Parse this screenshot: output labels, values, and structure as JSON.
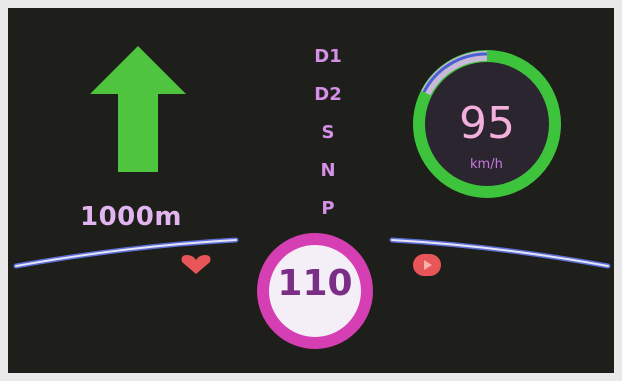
{
  "navigation": {
    "direction_icon": "arrow-up-icon",
    "distance": "1000m",
    "arrow_color": "#4ec43f"
  },
  "gear_selector": {
    "items": [
      "D1",
      "D2",
      "S",
      "N",
      "P"
    ],
    "color": "#d48fe6"
  },
  "speedometer": {
    "value": "95",
    "unit": "km/h",
    "ring_color": "#3ec43c",
    "accent_color": "#4a5fd0"
  },
  "speed_limit": {
    "value": "110",
    "border_color": "#d63fb4"
  },
  "indicators": {
    "left_icon": "heart-icon",
    "right_icon": "play-icon",
    "color": "#e8565a"
  }
}
